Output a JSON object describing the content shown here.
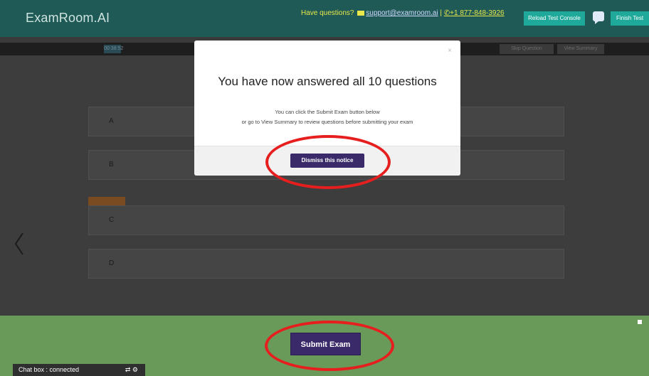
{
  "header": {
    "brand": "ExamRoom.AI",
    "questions_label": "Have questions?",
    "email": "support@examroom.ai",
    "separator": "|",
    "phone": "+1 877-848-3926",
    "reload_button": "Reload Test Console",
    "finish_button": "Finish Test"
  },
  "toolbar": {
    "timer": "00:38:52",
    "skip_button": "Skip Question",
    "summary_button": "View Summary"
  },
  "options": [
    {
      "letter": "A"
    },
    {
      "letter": "B"
    },
    {
      "letter": "C"
    },
    {
      "letter": "D"
    }
  ],
  "modal": {
    "close": "×",
    "title": "You have now answered all 10 questions",
    "line1": "You can click the Submit Exam button below",
    "line2": "or go to View Summary to review questions before submitting your exam",
    "dismiss_button": "Dismiss this notice"
  },
  "footer": {
    "submit_button": "Submit Exam",
    "chatbox_label": "Chat box : connected"
  },
  "colors": {
    "header_bg": "#1f5a57",
    "accent_teal": "#1fa99a",
    "primary_purple": "#3a2a6a",
    "footer_green": "#6a9a5a",
    "highlight_red": "#e61e1e"
  },
  "icons": [
    "mail-icon",
    "phone-icon",
    "chat-bubble-icon",
    "chevron-left-icon",
    "close-icon",
    "swap-icon",
    "gear-icon"
  ]
}
